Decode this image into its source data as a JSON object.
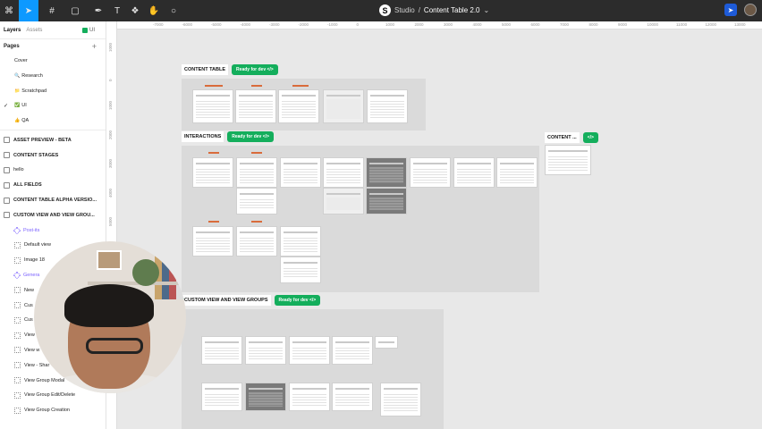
{
  "toolbar": {
    "tools": [
      "main-menu",
      "move-tool",
      "frame-tool",
      "shape-tool",
      "pen-tool",
      "text-tool",
      "component-tool",
      "hand-tool",
      "comment-tool"
    ],
    "breadcrumb_project": "Studio",
    "breadcrumb_separator": "/",
    "file_name": "Content Table 2.0",
    "accent_color": "#0d99ff"
  },
  "sidebar": {
    "tab_layers": "Layers",
    "tab_assets": "Assets",
    "current_page": "UI",
    "pages_title": "Pages",
    "pages": [
      {
        "label": "Cover",
        "emoji": "",
        "checked": false
      },
      {
        "label": "Research",
        "emoji": "🔍",
        "checked": false
      },
      {
        "label": "Scratchpad",
        "emoji": "📁",
        "checked": false
      },
      {
        "label": "UI",
        "emoji": "✅",
        "checked": true
      },
      {
        "label": "QA",
        "emoji": "👍",
        "checked": false
      }
    ],
    "layers": [
      {
        "label": "ASSET PREVIEW - BETA",
        "kind": "frame"
      },
      {
        "label": "CONTENT STAGES",
        "kind": "frame"
      },
      {
        "label": "hello",
        "kind": "plain"
      },
      {
        "label": "ALL FIELDS",
        "kind": "frame"
      },
      {
        "label": "CONTENT TABLE ALPHA VERSIO...",
        "kind": "frame"
      },
      {
        "label": "CUSTOM VIEW AND VIEW GROU...",
        "kind": "frame"
      },
      {
        "label": "Post-its",
        "kind": "purple"
      },
      {
        "label": "Default view",
        "kind": "child"
      },
      {
        "label": "Image 18",
        "kind": "child"
      },
      {
        "label": "Genera",
        "kind": "purple"
      },
      {
        "label": "New",
        "kind": "child"
      },
      {
        "label": "Cus",
        "kind": "child"
      },
      {
        "label": "Cus",
        "kind": "child"
      },
      {
        "label": "View",
        "kind": "child"
      },
      {
        "label": "View w",
        "kind": "child"
      },
      {
        "label": "View - Shar",
        "kind": "child"
      },
      {
        "label": "View Group Modal",
        "kind": "child"
      },
      {
        "label": "View Group Edit/Delete",
        "kind": "child"
      },
      {
        "label": "View Group Creation",
        "kind": "child"
      }
    ]
  },
  "rulers": {
    "top": [
      "-7000",
      "-6000",
      "-5000",
      "-4000",
      "-3000",
      "-2000",
      "-1000",
      "0",
      "1000",
      "2000",
      "3000",
      "4000",
      "5000",
      "6000",
      "7000",
      "8000",
      "9000",
      "10000",
      "11000",
      "12000",
      "13000"
    ],
    "left": [
      "1000",
      "0",
      "1000",
      "2000",
      "3000",
      "4000",
      "5000",
      "6000",
      "7000"
    ]
  },
  "canvas": {
    "sections": [
      {
        "title": "CONTENT TABLE",
        "status": "Ready for dev </>"
      },
      {
        "title": "INTERACTIONS",
        "status": "Ready for dev </>"
      },
      {
        "title": "CONTENT ...",
        "status": "</>"
      },
      {
        "title": "CUSTOM VIEW AND VIEW GROUPS",
        "status": "Ready for dev </>"
      }
    ],
    "status_color": "#14ae5c"
  }
}
